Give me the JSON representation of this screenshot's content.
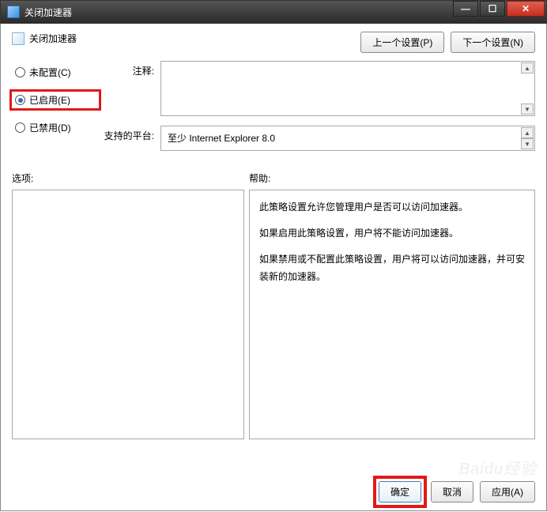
{
  "title": "关闭加速器",
  "header": {
    "heading": "关闭加速器",
    "prev_btn": "上一个设置(P)",
    "next_btn": "下一个设置(N)"
  },
  "radios": {
    "not_configured": "未配置(C)",
    "enabled": "已启用(E)",
    "disabled": "已禁用(D)",
    "selected": "enabled"
  },
  "fields": {
    "comment_label": "注释:",
    "comment_value": "",
    "platform_label": "支持的平台:",
    "platform_value": "至少 Internet Explorer 8.0"
  },
  "sections": {
    "options_label": "选项:",
    "help_label": "帮助:"
  },
  "help_text": {
    "p1": "此策略设置允许您管理用户是否可以访问加速器。",
    "p2": "如果启用此策略设置，用户将不能访问加速器。",
    "p3": "如果禁用或不配置此策略设置，用户将可以访问加速器，并可安装新的加速器。"
  },
  "footer": {
    "ok": "确定",
    "cancel": "取消",
    "apply": "应用(A)"
  },
  "watermark": "Baidu经验"
}
